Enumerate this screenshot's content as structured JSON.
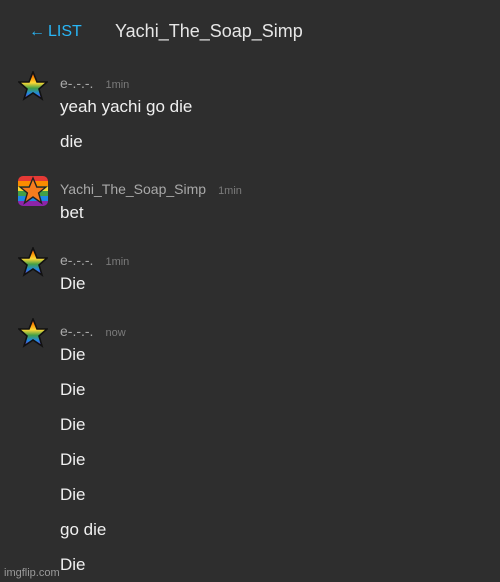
{
  "header": {
    "back_label": "LIST",
    "title": "Yachi_The_Soap_Simp"
  },
  "messages": [
    {
      "user": "e-.-.-.",
      "time": "1min",
      "lines": [
        "yeah yachi go die",
        "die"
      ]
    },
    {
      "user": "Yachi_The_Soap_Simp",
      "time": "1min",
      "lines": [
        "bet"
      ]
    },
    {
      "user": "e-.-.-.",
      "time": "1min",
      "lines": [
        "Die"
      ]
    },
    {
      "user": "e-.-.-.",
      "time": "now",
      "lines": [
        "Die",
        "Die",
        "Die",
        "Die",
        "Die",
        "go die",
        "Die"
      ]
    }
  ],
  "watermark": "imgflip.com",
  "colors": {
    "accent": "#29b6f6",
    "background": "#2e2e2e"
  },
  "icons": {
    "back": "left-arrow-icon",
    "avatar_e": "rainbow-star-icon",
    "avatar_yachi": "orange-star-on-rainbow-icon"
  }
}
